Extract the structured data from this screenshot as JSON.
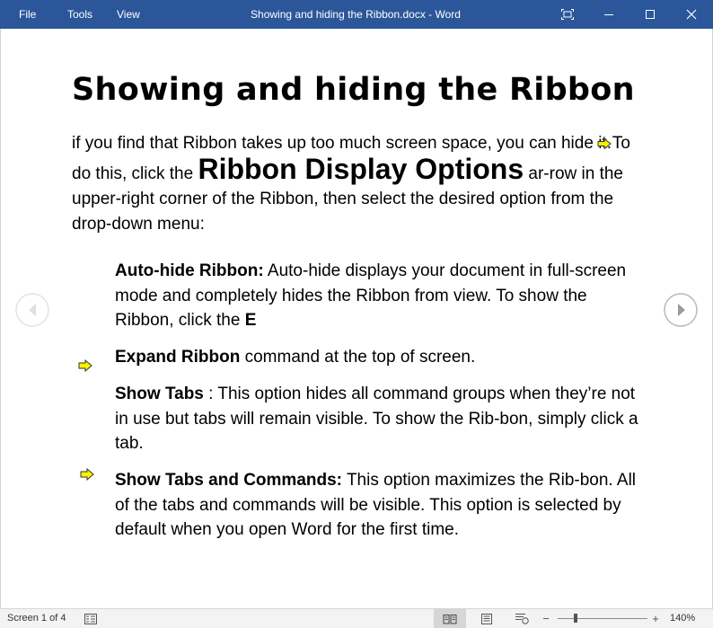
{
  "window": {
    "title": "Showing and hiding the Ribbon.docx  -  Word",
    "menu": [
      "File",
      "Tools",
      "View"
    ]
  },
  "document": {
    "heading": "Showing and hiding the Ribbon",
    "intro": {
      "part1": "if you find that Ribbon takes up too much screen space, you can hide it.",
      "part2": " To do this, click the ",
      "emphasis": "Ribbon Display Options",
      "part3": " ar-row in the upper-right corner of the Ribbon, then select the desired option from the drop-down menu:"
    },
    "items": [
      {
        "term": "Auto-hide Ribbon:",
        "text": " Auto-hide displays your document in full-screen mode and      completely hides the Ribbon from view. To show the Ribbon, click the ",
        "tail": "E"
      },
      {
        "term": "Expand Ribbon",
        "text": " command at the top of screen."
      },
      {
        "term": "Show Tabs",
        "text": " : This option hides all command groups when they’re not in use but tabs will remain visible. To show the Rib-bon, simply click a tab."
      },
      {
        "term": "Show Tabs and Commands:",
        "text": " This option maximizes the Rib-bon. All of the tabs and commands will be visible. This option is selected by default when you open Word for the first time."
      }
    ]
  },
  "statusbar": {
    "page": "Screen 1 of 4",
    "zoom": "140%",
    "zoom_fraction": 0.2
  },
  "colors": {
    "titlebar": "#2b579a",
    "arrow_fill": "#f7f300"
  }
}
